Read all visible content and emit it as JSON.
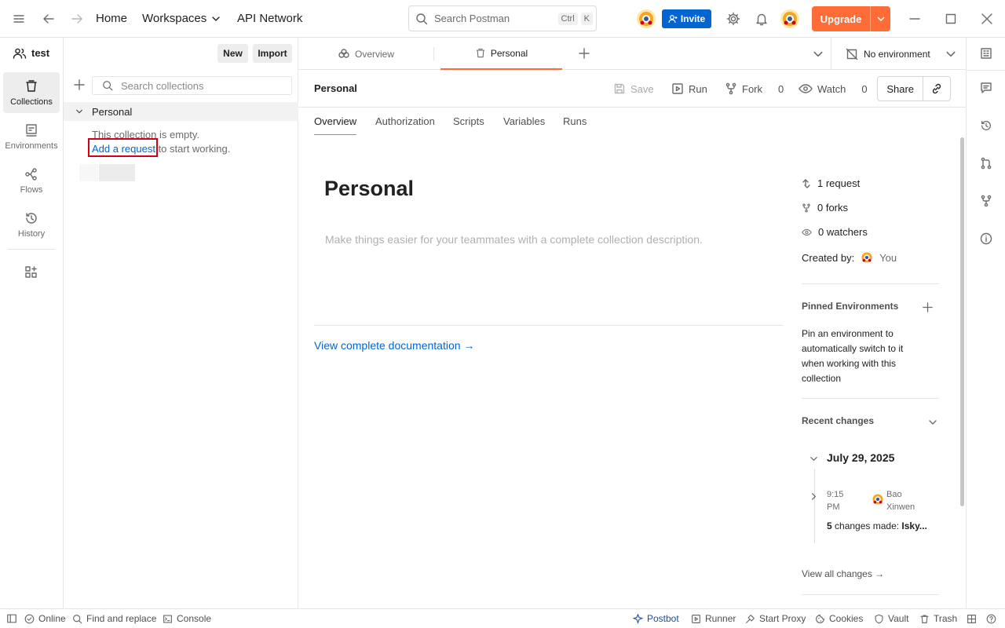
{
  "titlebar": {
    "home": "Home",
    "workspaces": "Workspaces",
    "api_network": "API Network",
    "search_placeholder": "Search Postman",
    "shortcut_ctrl": "Ctrl",
    "shortcut_k": "K",
    "invite": "Invite",
    "upgrade": "Upgrade"
  },
  "rail": {
    "items": [
      {
        "label": "Collections",
        "icon": "collections-icon"
      },
      {
        "label": "Environments",
        "icon": "environments-icon"
      },
      {
        "label": "Flows",
        "icon": "flows-icon"
      },
      {
        "label": "History",
        "icon": "history-icon"
      }
    ]
  },
  "workspace": {
    "name": "test",
    "new_label": "New",
    "import_label": "Import"
  },
  "collections": {
    "search_placeholder": "Search collections",
    "tree_item": "Personal",
    "empty_line1": "This collection is empty.",
    "add_request_link": "Add a request",
    "empty_line2": " to start working."
  },
  "tabs": {
    "overview": "Overview",
    "personal": "Personal",
    "environment": "No environment"
  },
  "content": {
    "title": "Personal",
    "save": "Save",
    "run": "Run",
    "fork": "Fork",
    "fork_count": "0",
    "watch": "Watch",
    "watch_count": "0",
    "share": "Share",
    "subtabs": [
      "Overview",
      "Authorization",
      "Scripts",
      "Variables",
      "Runs"
    ],
    "heading": "Personal",
    "description_placeholder": "Make things easier for your teammates with a complete collection description.",
    "view_docs": "View complete documentation →"
  },
  "meta": {
    "requests": "1 request",
    "forks": "0 forks",
    "watchers": "0 watchers",
    "created_by_label": "Created by:",
    "created_by": "You",
    "pinned_title": "Pinned Environments",
    "pinned_desc": "Pin an environment to automatically switch to it when working with this collection",
    "recent_title": "Recent changes",
    "recent_date": "July 29, 2025",
    "recent_time": "9:15 PM",
    "recent_user": "Bao Xinwen",
    "recent_count": "5",
    "recent_changes_text": " changes made: ",
    "recent_target": "Isky...",
    "view_all": "View all changes →"
  },
  "statusbar": {
    "online": "Online",
    "find_replace": "Find and replace",
    "console": "Console",
    "postbot": "Postbot",
    "runner": "Runner",
    "start_proxy": "Start Proxy",
    "cookies": "Cookies",
    "vault": "Vault",
    "trash": "Trash"
  },
  "colors": {
    "accent": "#ff6c37",
    "invite": "#0265d2",
    "link": "#0265d2",
    "highlight_box": "#d0021b"
  }
}
